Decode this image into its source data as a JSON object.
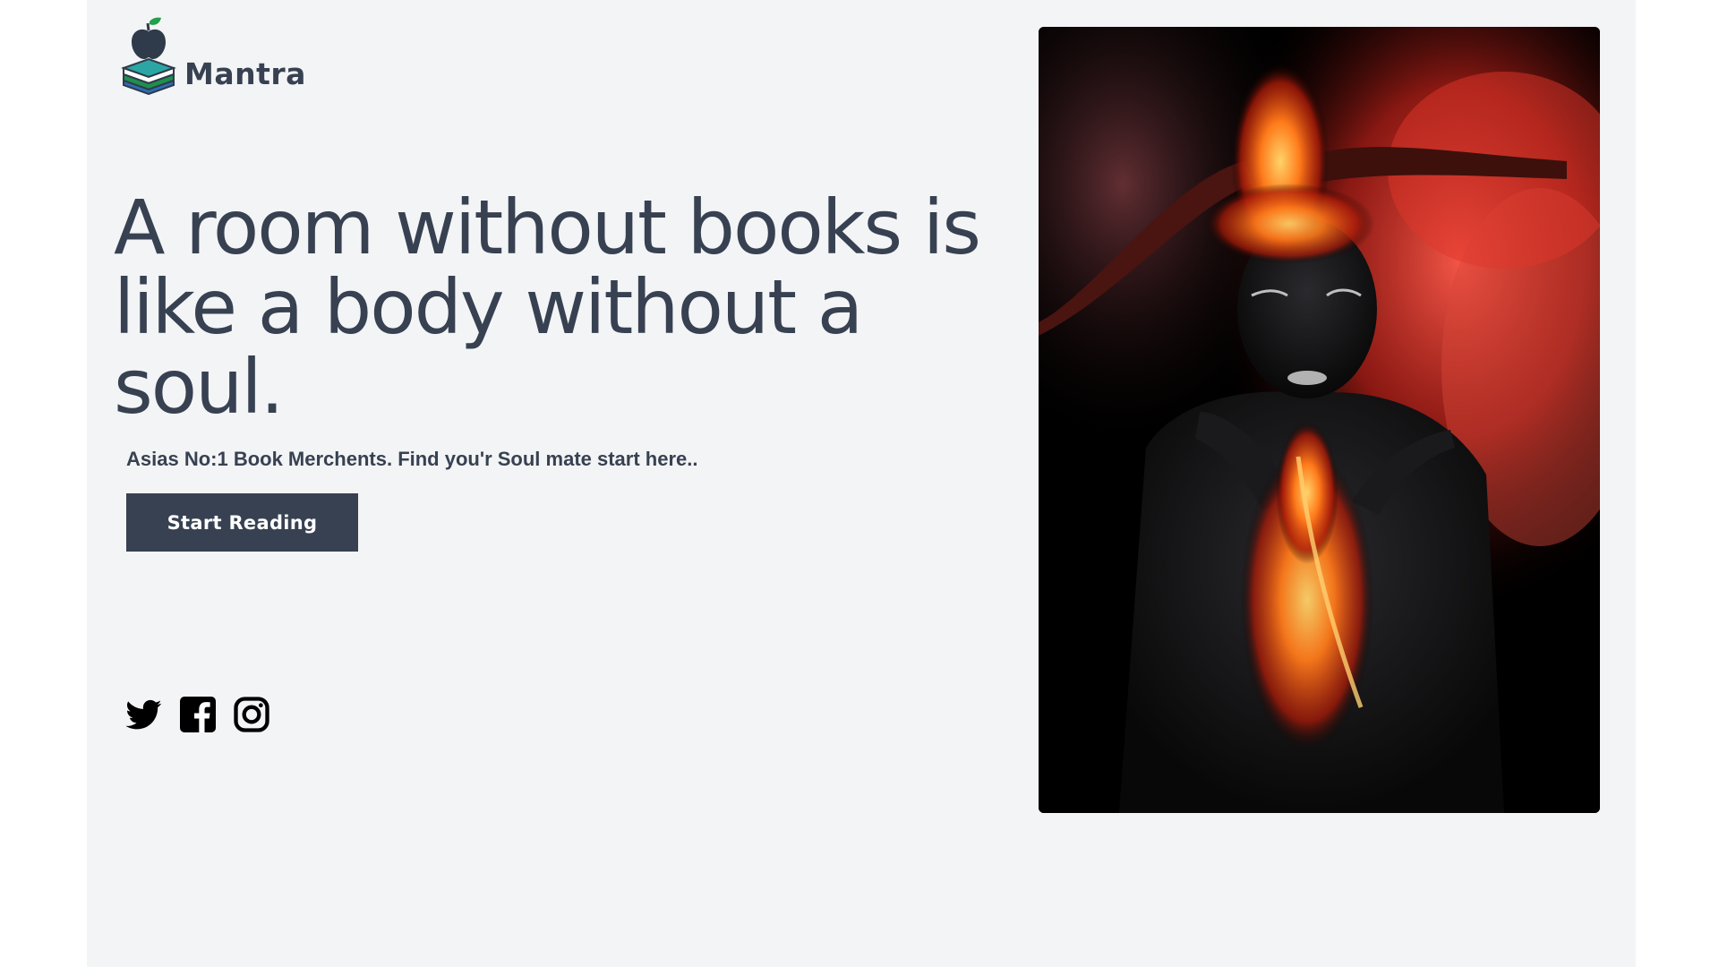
{
  "brand": {
    "name": "Mantra",
    "colors": {
      "primary": "#374151",
      "apple": "#2f3b4a",
      "leaf": "#22a04b",
      "book_teal": "#2ca6a4",
      "book_green": "#1f8f4e",
      "book_blue": "#2d6db5"
    }
  },
  "hero": {
    "headline": "A room without books is like a body without a soul.",
    "tagline": "Asias No:1 Book Merchents. Find you'r Soul mate start here..",
    "cta_label": "Start Reading",
    "image_icon": "fire-portrait-image"
  },
  "social": [
    {
      "icon": "twitter-icon"
    },
    {
      "icon": "facebook-icon"
    },
    {
      "icon": "instagram-icon"
    }
  ],
  "colors": {
    "page_background": "#f3f4f6",
    "text": "#374151",
    "button_bg": "#374151",
    "button_text": "#ffffff"
  }
}
